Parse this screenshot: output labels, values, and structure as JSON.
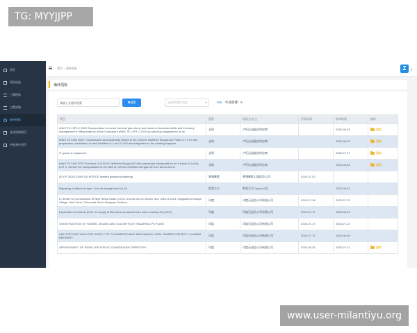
{
  "overlay": {
    "tag": "TG: MYYJJPP",
    "watermark": "www.user-milantiyu.org"
  },
  "sidebar": {
    "items": [
      {
        "label": "首页",
        "icon": "home-icon"
      },
      {
        "label": "项目机会",
        "icon": "doc-icon"
      },
      {
        "label": "三期招标",
        "icon": "list-icon"
      },
      {
        "label": "三期采购",
        "icon": "list-icon"
      },
      {
        "label": "海外招标",
        "icon": "globe-icon",
        "active": true
      },
      {
        "label": "全球采购项目",
        "icon": "doc-icon"
      },
      {
        "label": "中标海外项目",
        "icon": "doc-icon"
      }
    ]
  },
  "header": {
    "breadcrumb": [
      "首页",
      "海外招标"
    ],
    "logo_text": "Z"
  },
  "page": {
    "title": "海外招标"
  },
  "filters": {
    "search_placeholder": "请输入关键词搜索",
    "search_button": "搜索",
    "select_placeholder": "请选择国家/地区",
    "stats_total": "585",
    "stats_today": "今日新增：6"
  },
  "table": {
    "headers": [
      "项目",
      "国家",
      "招标方/业主",
      "开标时间",
      "发布时间",
      "操作"
    ],
    "rows": [
      {
        "project": "eNeS TK LSPLC 2020 Transportation of motor fuel and gas oils by auto tanks in domestic traffic and inventory management in filling stations of the Company's eNeS TK LSPLC 2020 na auto/buy magazynow no iw",
        "country": "全球",
        "owner": "卢旺达油副总供应商",
        "open": "",
        "publish": "2020-08-03",
        "action": "跟踪"
      },
      {
        "project": "eNeS TK LNM 2020 +Construction-and-Assembly Works in the LUKOIL Neftehim Burgas AD Plants C7 F for site preparation, installation of vent Facilities O-1 and O-3/O and integration in the existing equipme",
        "country": "全球",
        "owner": "卢旺达油副总供应商",
        "open": "",
        "publish": "2020-08-03",
        "action": "跟踪"
      },
      {
        "project": "IT goods & equipment",
        "country": "全球",
        "owner": "卢旺达油副总供应商",
        "open": "",
        "publish": "2020-07-27",
        "action": "跟踪"
      },
      {
        "project": "eNeS TK LNM 2020 Provision of LUKOIL Neftehim Burgas AD with passenger transportation for 5 years (2 LoSs): LOT 1: Service for transportation of the staff of LUKOIL Neftehim Burgas AD from and to the w",
        "country": "全球",
        "owner": "卢旺达油副总供应商",
        "open": "",
        "publish": "2020-08-03",
        "action": "跟踪"
      },
      {
        "project": "(EU IP 2020) (2009-10) NOTICE (limited glassblock/grating)",
        "country": "柬埔寨欧",
        "owner": "柬埔寨欧公路局总公司",
        "open": "2020-07-20",
        "publish": "",
        "action": ""
      },
      {
        "project": "Repairing of filled roof type. Fuel oil storage tank No.4A",
        "country": "斯里兰卡",
        "owner": "斯里兰卡Ceylon公司",
        "open": "",
        "publish": "2020-08-03",
        "action": ""
      },
      {
        "project": "E-Tender for Construction of New Retail Outlet COCO at rural city on Survey Nos. 4/4/5 & 5/4/3, Nagpadhi to Kuppa Village, Hadi Taluk, Chhanvad Dist in Belgaum Territory",
        "country": "印度",
        "owner": "印度石油总公司有限公司",
        "open": "2020-07-16",
        "publish": "2020-07-23",
        "action": ""
      },
      {
        "project": "Expression of Interest (EOI) for supply of Bio-diesel produced from used Cooking Oil (UCO)",
        "country": "印度",
        "owner": "印度石油总公司有限公司",
        "open": "2020-07-17",
        "publish": "2020-08-13",
        "action": ""
      },
      {
        "project": "CONSTRUCTION OF SEABIS, DRAINS AND CULVERTS AT RANAPAN LPS PLANT",
        "country": "印度",
        "owner": "印度石油总公司有限公司",
        "open": "2020-07-17",
        "publish": "2020-07-23",
        "action": ""
      },
      {
        "project": "ARC FOR ONE YEAR FOR SUPPLY OF FLOWBRIVE MAKE MECHANICAL SEAL SPARES FOR BPC-L MUMBAI REFINERY",
        "country": "印度",
        "owner": "印度石油总公司有限公司",
        "open": "2020-07-17",
        "publish": "2020-08-06",
        "action": ""
      },
      {
        "project": "APPOINTMENT OF RESELLER FOR AC CHANDIGARH TERRITORY",
        "country": "印度",
        "owner": "印度石油总公司有限公司",
        "open": "2020-08-25",
        "publish": "2020-07-21",
        "action": "跟踪"
      }
    ]
  },
  "colors": {
    "sidebar_bg": "#263445",
    "accent": "#2d8cf0",
    "title_accent": "#f0b400",
    "row_alt": "#dce7f3"
  }
}
